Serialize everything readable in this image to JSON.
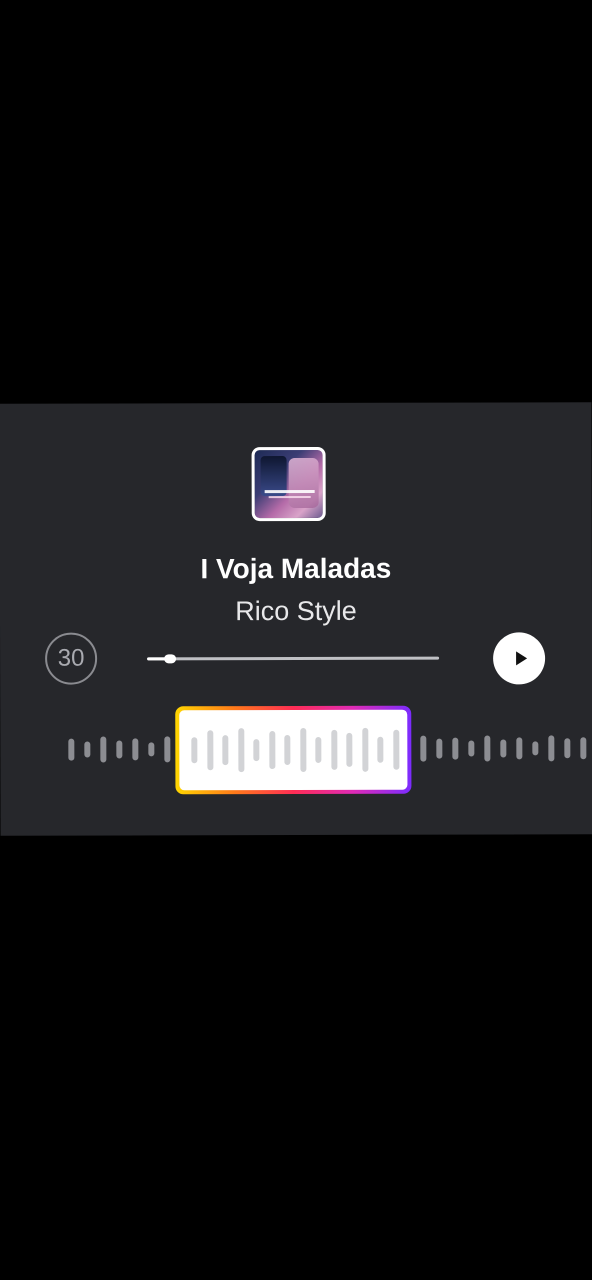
{
  "song": {
    "title": "I Voja Maladas",
    "artist": "Rico Style"
  },
  "album_art": {
    "icon": "album-cover-image",
    "accent_colors": [
      "#1d2a55",
      "#b46ba8",
      "#d9a3c9"
    ]
  },
  "player": {
    "duration_label": "30",
    "progress_fraction": 0.08,
    "play_icon": "play-icon"
  },
  "waveform": {
    "bar_color": "#8c8d92",
    "selected_bar_color": "#d2d3d6",
    "selection_gradient": [
      "#ffd600",
      "#ff7a1a",
      "#ff2d55",
      "#e02bb5",
      "#7b2cff"
    ]
  },
  "colors": {
    "background": "#000000",
    "sheet": "#26272b",
    "text_primary": "#ffffff",
    "text_secondary": "#e8e8ea"
  }
}
